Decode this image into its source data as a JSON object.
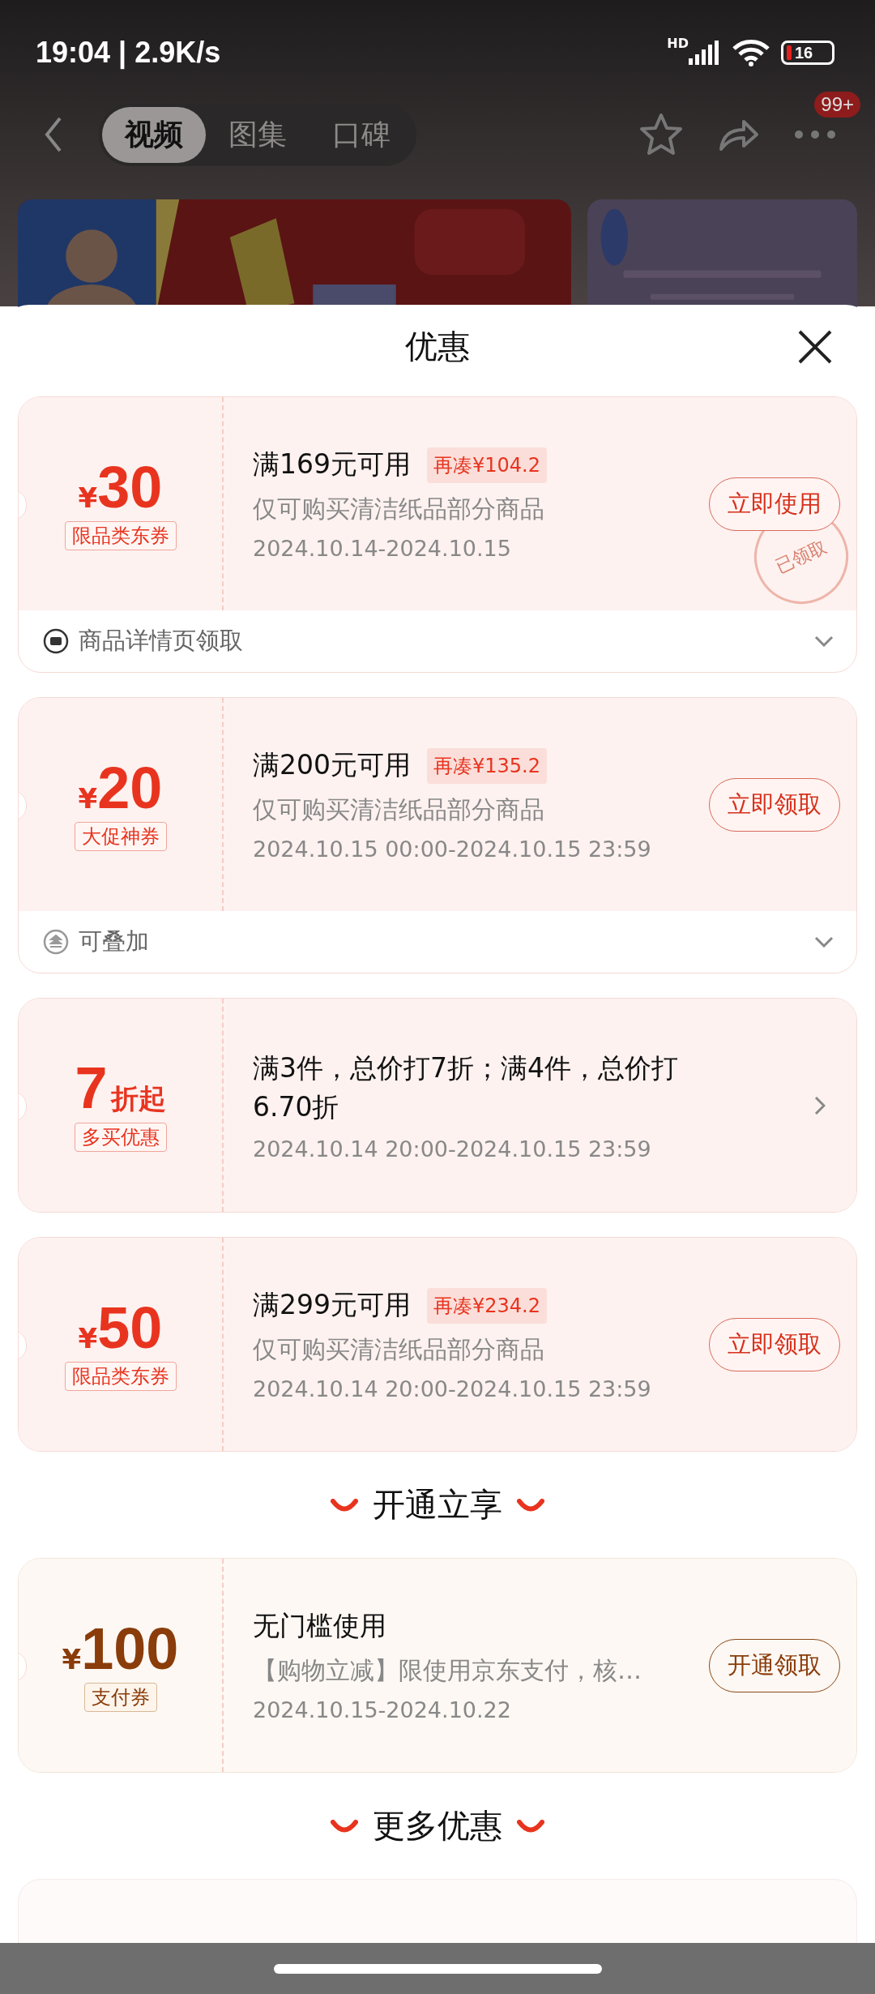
{
  "status_bar": {
    "time": "19:04 | 2.9K/s",
    "network": "HD",
    "battery": "16"
  },
  "nav": {
    "tabs": [
      {
        "label": "视频",
        "selected": true
      },
      {
        "label": "图集",
        "selected": false
      },
      {
        "label": "口碑",
        "selected": false
      }
    ],
    "badge": "99+"
  },
  "sheet": {
    "title": "优惠",
    "groups": [
      {
        "coupons": [
          {
            "kind": "cash",
            "currency": "¥",
            "amount": "30",
            "tag": "限品类东券",
            "condition": "满169元可用",
            "gap": "再凑¥104.2",
            "scope": "仅可购买清洁纸品部分商品",
            "period": "2024.10.14-2024.10.15",
            "action": "立即使用",
            "stamp": "已领取",
            "footer": {
              "kind": "source",
              "text": "商品详情页领取"
            }
          },
          {
            "kind": "cash",
            "currency": "¥",
            "amount": "20",
            "tag": "大促神券",
            "condition": "满200元可用",
            "gap": "再凑¥135.2",
            "scope": "仅可购买清洁纸品部分商品",
            "period": "2024.10.15 00:00-2024.10.15 23:59",
            "action": "立即领取",
            "footer": {
              "kind": "stackable",
              "text": "可叠加"
            }
          },
          {
            "kind": "discount",
            "amount": "7",
            "unit": "折起",
            "tag": "多买优惠",
            "condition": "满3件，总价打7折；满4件，总价打6.70折",
            "period": "2024.10.14 20:00-2024.10.15 23:59"
          },
          {
            "kind": "cash",
            "currency": "¥",
            "amount": "50",
            "tag": "限品类东券",
            "condition": "满299元可用",
            "gap": "再凑¥234.2",
            "scope": "仅可购买清洁纸品部分商品",
            "period": "2024.10.14 20:00-2024.10.15 23:59",
            "action": "立即领取"
          }
        ]
      },
      {
        "heading": "开通立享",
        "coupons": [
          {
            "kind": "pay",
            "currency": "¥",
            "amount": "100",
            "tag": "支付券",
            "condition": "无门槛使用",
            "scope": "【购物立减】限使用京东支付，核…",
            "period": "2024.10.15-2024.10.22",
            "action": "开通领取"
          }
        ]
      },
      {
        "heading": "更多优惠",
        "coupons": [
          {
            "kind": "partial"
          }
        ]
      }
    ]
  }
}
